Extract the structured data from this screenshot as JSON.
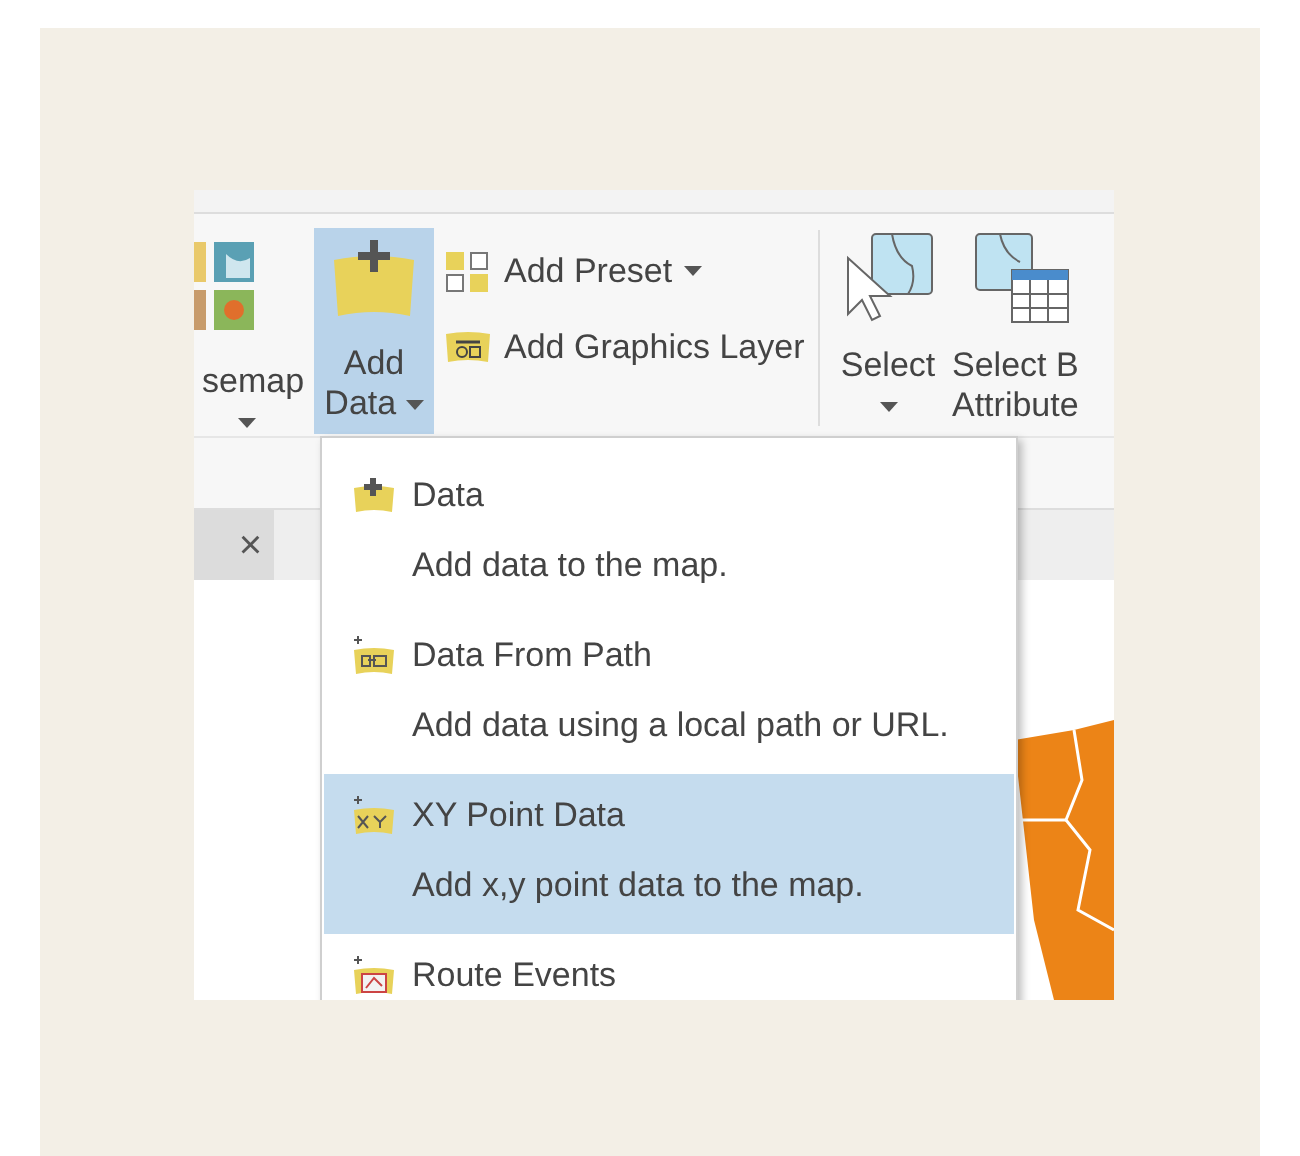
{
  "ribbon": {
    "basemap": {
      "label": "semap"
    },
    "add_data": {
      "label_1": "Add",
      "label_2": "Data",
      "selected": true
    },
    "layer_tools": [
      {
        "label": "Add Preset",
        "kind": "dropdown"
      },
      {
        "label": "Add Graphics Layer",
        "kind": "plain"
      }
    ],
    "select": {
      "label": "Select"
    },
    "select_by": {
      "label_1": "Select B",
      "label_2": "Attribute"
    }
  },
  "document_tab": {
    "close": "×"
  },
  "menu": {
    "items": [
      {
        "title": "Data",
        "description": "Add data to the map.",
        "selected": false
      },
      {
        "title": "Data From Path",
        "description": "Add data using a local path or URL.",
        "selected": false
      },
      {
        "title": "XY Point Data",
        "description": "Add x,y point data to the map.",
        "selected": true
      },
      {
        "title": "Route Events",
        "selected": false
      }
    ]
  }
}
